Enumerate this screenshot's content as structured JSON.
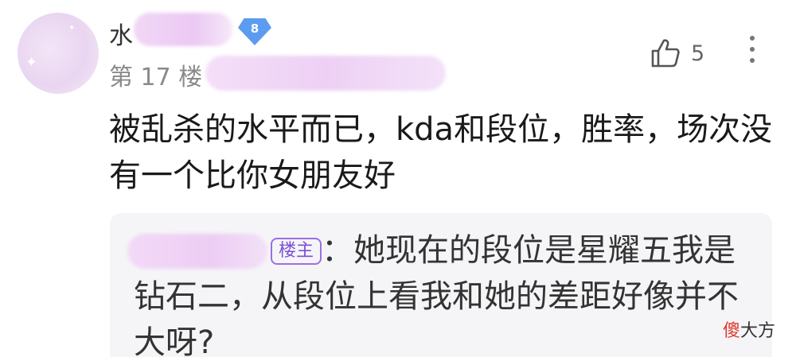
{
  "post": {
    "username_initial": "水",
    "level": "8",
    "floor": "第 17 楼",
    "likes": "5",
    "content": "被乱杀的水平而已，kda和段位，胜率，场次没有一个比你女朋友好"
  },
  "quote": {
    "badge": "楼主",
    "separator": "：",
    "text": "她现在的段位是星耀五我是钻石二，从段位上看我和她的差距好像并不大呀?"
  },
  "watermark": {
    "char1": "傻",
    "rest": "大方"
  },
  "icons": {
    "like": "thumbs-up-icon",
    "more": "more-vertical-icon"
  },
  "colors": {
    "accent_badge": "#5b9cf0",
    "lz_badge": "#7c4fd6",
    "watermark_red": "#e03a2f"
  }
}
